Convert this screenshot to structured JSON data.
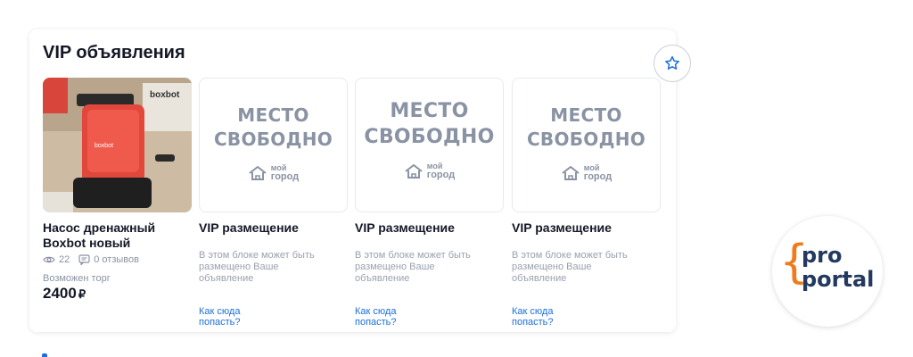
{
  "section": {
    "title": "VIP объявления"
  },
  "colors": {
    "accent": "#1a6fdc",
    "brand_orange": "#f07b1a",
    "brand_navy": "#23395e",
    "muted": "#8a93a3"
  },
  "listing": {
    "title": "Насос дренажный Boxbot новый",
    "views": "22",
    "reviews": "0 отзывов",
    "bargain": "Возможен торг",
    "price": "2400",
    "currency": "₽",
    "icons": {
      "views": "eye-icon",
      "reviews": "comment-icon"
    }
  },
  "vip_slots": [
    {
      "placeholder_line1": "МЕСТО",
      "placeholder_line2": "СВОБОДНО",
      "logo_line1": "мой",
      "logo_line2": "город",
      "title": "VIP размещение",
      "description": "В этом блоке может быть размещено Ваше объявление",
      "link": "Как сюда попасть?"
    },
    {
      "placeholder_line1": "МЕСТО",
      "placeholder_line2": "СВОБОДНО",
      "logo_line1": "мой",
      "logo_line2": "город",
      "title": "VIP размещение",
      "description": "В этом блоке может быть размещено Ваше объявление",
      "link": "Как сюда попасть?"
    },
    {
      "placeholder_line1": "МЕСТО",
      "placeholder_line2": "СВОБОДНО",
      "logo_line1": "мой",
      "logo_line2": "город",
      "title": "VIP размещение",
      "description": "В этом блоке может быть размещено Ваше объявление",
      "link": "Как сюда попасть?"
    }
  ],
  "badge": {
    "line1": "pro",
    "line2": "portal",
    "brace": "{"
  },
  "photo_label": "boxbot",
  "favorite_icon": "star-icon"
}
